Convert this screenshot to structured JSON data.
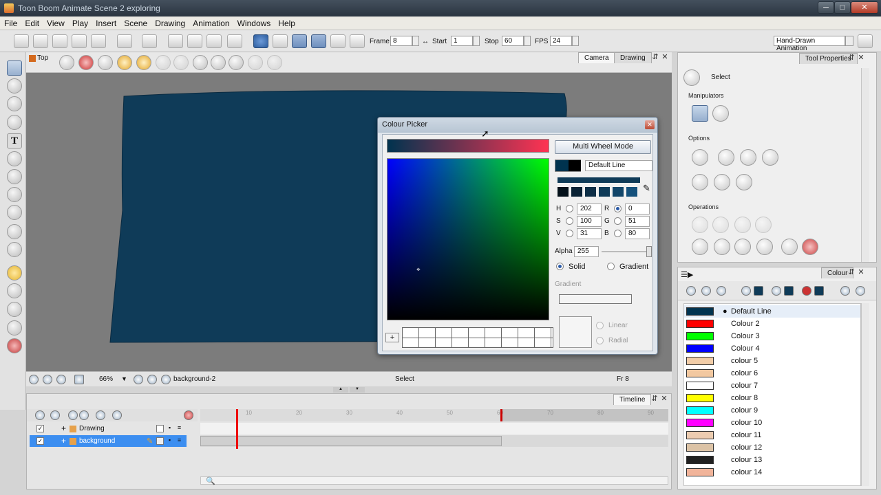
{
  "app": {
    "title": "Toon Boom Animate Scene 2 exploring",
    "win_min": "─",
    "win_max": "□",
    "win_close": "✕"
  },
  "menu": [
    "File",
    "Edit",
    "View",
    "Play",
    "Insert",
    "Scene",
    "Drawing",
    "Animation",
    "Windows",
    "Help"
  ],
  "toolbar": {
    "frame_label": "Frame",
    "frame_value": "8",
    "start_label": "Start",
    "start_value": "1",
    "stop_label": "Stop",
    "stop_value": "60",
    "fps_label": "FPS",
    "fps_value": "24",
    "workspace": "Hand-Drawn Animation"
  },
  "view": {
    "top_label": "Top",
    "tab_camera": "Camera",
    "tab_drawing": "Drawing"
  },
  "status": {
    "zoom": "66%",
    "layer": "background-2",
    "tool": "Select",
    "frame": "Fr 8"
  },
  "timeline": {
    "tab": "Timeline",
    "layers": [
      {
        "name": "Drawing",
        "checked": true
      },
      {
        "name": "background",
        "checked": true
      }
    ],
    "ruler": [
      "10",
      "20",
      "30",
      "40",
      "50",
      "60",
      "70",
      "80",
      "90"
    ]
  },
  "tool_properties": {
    "tab": "Tool Properties",
    "tool_name": "Select",
    "section_manipulators": "Manipulators",
    "section_options": "Options",
    "section_operations": "Operations"
  },
  "colour_panel": {
    "tab": "Colour",
    "swatches": [
      {
        "name": "Default Line",
        "color": "#00334f",
        "selected": true
      },
      {
        "name": "Colour 2",
        "color": "#ff0000"
      },
      {
        "name": "Colour 3",
        "color": "#00ff00"
      },
      {
        "name": "Colour 4",
        "color": "#0000ff"
      },
      {
        "name": "colour 5",
        "color": "#f2cda8"
      },
      {
        "name": "colour 6",
        "color": "#f2c8a0"
      },
      {
        "name": "colour 7",
        "color": "#ffffff"
      },
      {
        "name": "colour 8",
        "color": "#ffff00"
      },
      {
        "name": "colour 9",
        "color": "#00ffff"
      },
      {
        "name": "colour 10",
        "color": "#ff00ff"
      },
      {
        "name": "colour 11",
        "color": "#ecccb0"
      },
      {
        "name": "colour 12",
        "color": "#dcc3a6"
      },
      {
        "name": "colour 13",
        "color": "#202020"
      },
      {
        "name": "colour 14",
        "color": "#f1b49a"
      }
    ]
  },
  "picker": {
    "title": "Colour Picker",
    "mode_button": "Multi Wheel Mode",
    "colour_name": "Default Line",
    "current_color": "#00334f",
    "h": "202",
    "s": "100",
    "v": "31",
    "r": "0",
    "g": "51",
    "b": "80",
    "alpha_label": "Alpha",
    "alpha": "255",
    "solid": "Solid",
    "gradient": "Gradient",
    "gradient_label": "Gradient",
    "linear": "Linear",
    "radial": "Radial",
    "add": "+"
  },
  "canvas": {
    "shape_color": "#0f3b58",
    "background": "#7c7c7c"
  }
}
